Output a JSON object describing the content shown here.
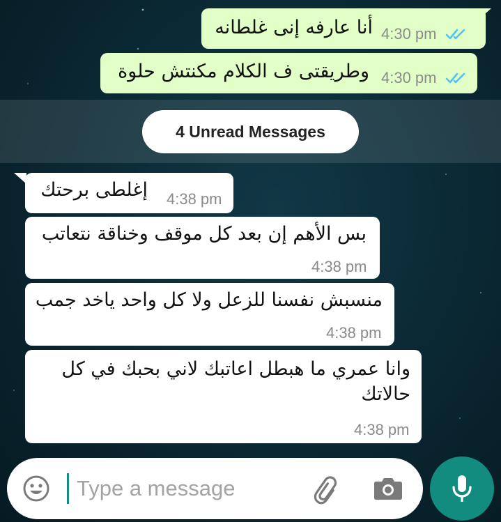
{
  "outgoing": [
    {
      "text": "أنا عارفه إنى غلطانه",
      "time": "4:30 pm",
      "status": "read"
    },
    {
      "text": "وطريقتى ف الكلام مكنتش حلوة",
      "time": "4:30 pm",
      "status": "read"
    }
  ],
  "unread": {
    "label": "4 Unread Messages"
  },
  "incoming": [
    {
      "text": "إغلطى برحتك",
      "time": "4:38 pm"
    },
    {
      "text": "بس الأهم إن بعد كل موقف وخناقة نتعاتب",
      "time": "4:38 pm"
    },
    {
      "text": "منسبش نفسنا للزعل ولا كل واحد ياخد جمب",
      "time": "4:38 pm"
    },
    {
      "text": "وانا عمري ما هبطل اعاتبك لاني بحبك في كل حالاتك",
      "time": "4:38 pm"
    }
  ],
  "composer": {
    "placeholder": "Type a message",
    "emoji_icon": "emoji-icon",
    "attach_icon": "paperclip-icon",
    "camera_icon": "camera-icon",
    "mic_icon": "microphone-icon"
  },
  "colors": {
    "outgoing_bubble": "#e1ffc7",
    "incoming_bubble": "#ffffff",
    "read_ticks": "#4fc3f7",
    "accent": "#128c7e"
  }
}
